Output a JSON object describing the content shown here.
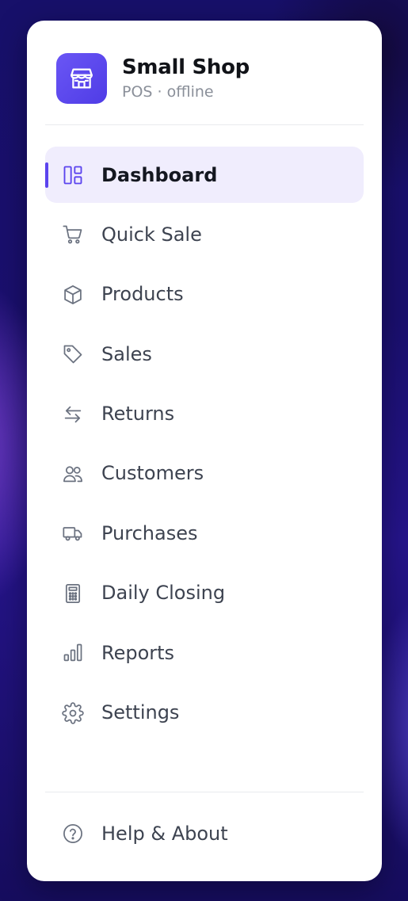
{
  "brand": {
    "name": "Small Shop",
    "subtitle": "POS · offline",
    "icon": "storefront-icon",
    "accent": "#5b44ee"
  },
  "nav": {
    "active": "Dashboard",
    "items": [
      {
        "label": "Dashboard",
        "icon": "dashboard-icon"
      },
      {
        "label": "Quick Sale",
        "icon": "cart-icon"
      },
      {
        "label": "Products",
        "icon": "box-icon"
      },
      {
        "label": "Sales",
        "icon": "tag-icon"
      },
      {
        "label": "Returns",
        "icon": "swap-arrows-icon"
      },
      {
        "label": "Customers",
        "icon": "users-icon"
      },
      {
        "label": "Purchases",
        "icon": "truck-icon"
      },
      {
        "label": "Daily Closing",
        "icon": "calculator-icon"
      },
      {
        "label": "Reports",
        "icon": "bar-chart-icon"
      },
      {
        "label": "Settings",
        "icon": "gear-icon"
      }
    ]
  },
  "footer": {
    "help_label": "Help & About",
    "icon": "help-circle-icon"
  }
}
